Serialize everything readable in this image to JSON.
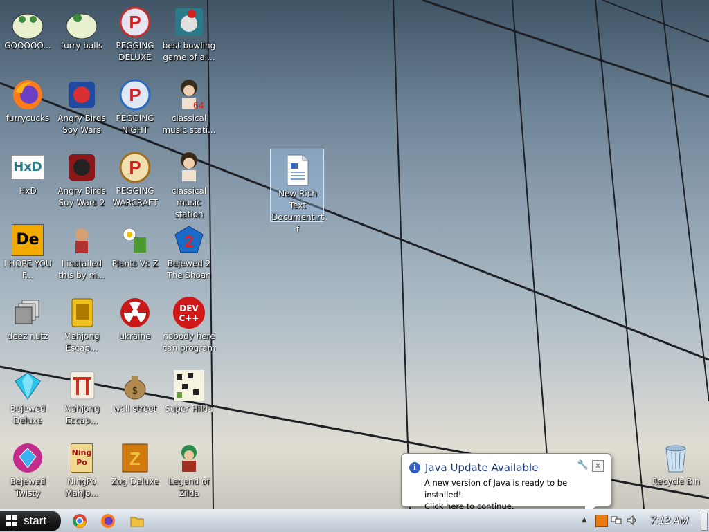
{
  "desktop": {
    "icons": [
      {
        "label": "GOOOOO..."
      },
      {
        "label": "furry balls"
      },
      {
        "label": "PEGGING DELUXE"
      },
      {
        "label": "best bowling game of al..."
      },
      {
        "label": "furrycucks"
      },
      {
        "label": "Angry Birds Soy Wars"
      },
      {
        "label": "PEGGING NIGHT"
      },
      {
        "label": "classical music stati..."
      },
      {
        "label": "HxD"
      },
      {
        "label": "Angry Birds Soy Wars 2"
      },
      {
        "label": "PEGGING WARCRAFT"
      },
      {
        "label": "classical music station"
      },
      {
        "label": "I HOPE YOU F..."
      },
      {
        "label": "I installed this by m..."
      },
      {
        "label": "Plants Vs Z"
      },
      {
        "label": "Bejewed 2 The Shoah"
      },
      {
        "label": "deez nutz"
      },
      {
        "label": "Mahjong Escap..."
      },
      {
        "label": "ukraine"
      },
      {
        "label": "nobody here can program"
      },
      {
        "label": "Bejewed Deluxe"
      },
      {
        "label": "Mahjong Escap..."
      },
      {
        "label": "wall street"
      },
      {
        "label": "Super Hilda"
      },
      {
        "label": "Bejewed Twisty"
      },
      {
        "label": "NingPo MahJo..."
      },
      {
        "label": "Zog Deluxe"
      },
      {
        "label": "Legend of Zilda"
      },
      {
        "label": "New Rich Text Document.rtf"
      },
      {
        "label": "Recycle Bin"
      }
    ],
    "icon_glyphs": {
      "hxd": "HxD",
      "dev": "DEV\nC++",
      "de": "De",
      "peg": "P",
      "bejewed2": "2",
      "ningpo": "Ning Po"
    }
  },
  "taskbar": {
    "start_label": "start",
    "clock": "7:12 AM"
  },
  "balloon": {
    "title": "Java Update Available",
    "line1": "A new version of Java is ready to be installed!",
    "line2": "Click here to continue.",
    "close": "x"
  }
}
